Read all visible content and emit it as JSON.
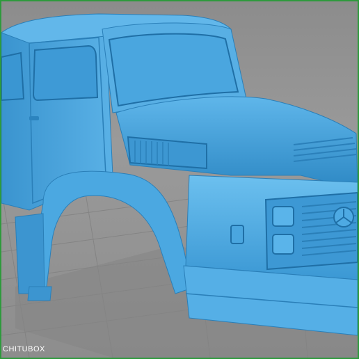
{
  "app": {
    "watermark_text": "CHITUBOX"
  },
  "viewport": {
    "background_color": "#929292",
    "model_color": "#3f9ed8",
    "grid_color": "#7a7a7a",
    "border_color": "#2e9a3c"
  }
}
